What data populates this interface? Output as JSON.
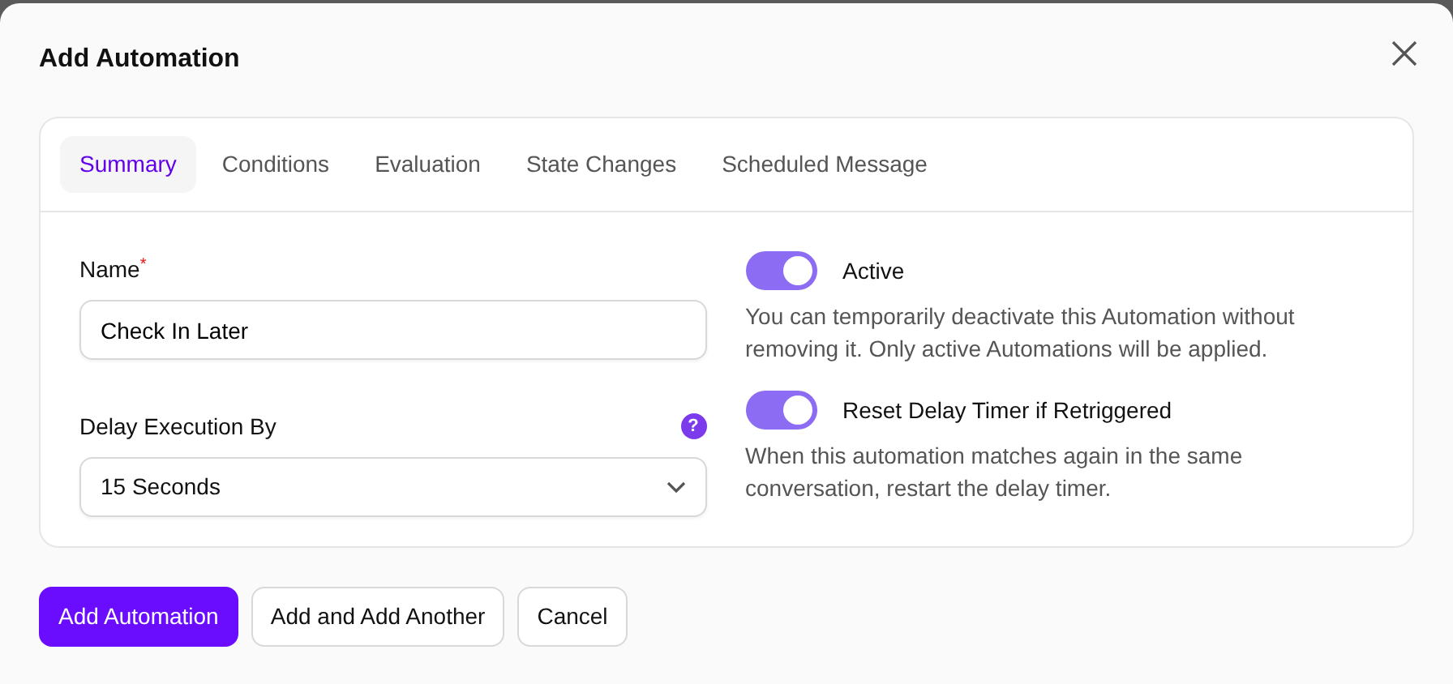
{
  "dialog": {
    "title": "Add Automation",
    "tabs": [
      {
        "label": "Summary",
        "selected": true
      },
      {
        "label": "Conditions",
        "selected": false
      },
      {
        "label": "Evaluation",
        "selected": false
      },
      {
        "label": "State Changes",
        "selected": false
      },
      {
        "label": "Scheduled Message",
        "selected": false
      }
    ],
    "fields": [
      {
        "kind": "text",
        "label": "Name",
        "required_mark": "*",
        "value": "Check In Later"
      },
      {
        "kind": "select",
        "label": "Delay Execution By",
        "help_icon": "?",
        "value": "15 Seconds"
      }
    ],
    "toggles": [
      {
        "label": "Active",
        "on": true,
        "description": "You can temporarily deactivate this Automation without removing it. Only active Automations will be applied."
      },
      {
        "label": "Reset Delay Timer if Retriggered",
        "on": true,
        "description": "When this automation matches again in the same conversation, restart the delay timer."
      }
    ],
    "buttons": [
      {
        "label": "Add Automation",
        "kind": "primary"
      },
      {
        "label": "Add and Add Another",
        "kind": "secondary"
      },
      {
        "label": "Cancel",
        "kind": "secondary"
      }
    ]
  }
}
